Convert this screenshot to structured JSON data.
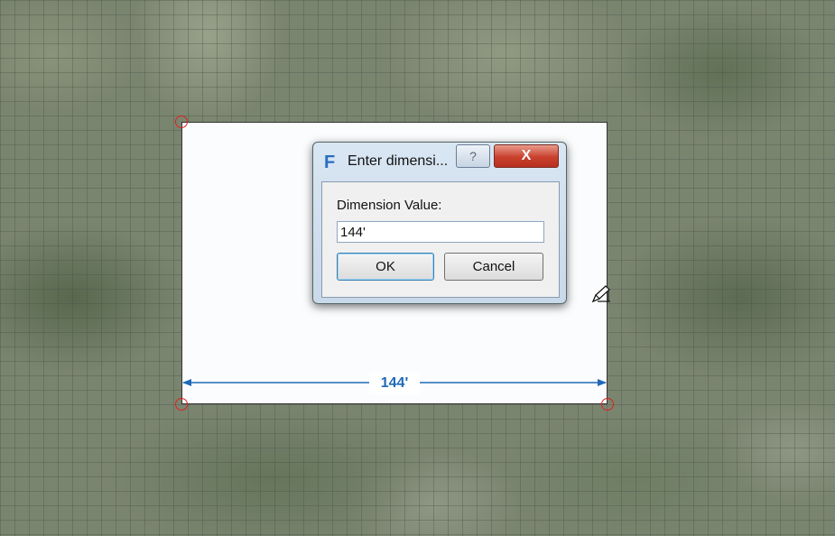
{
  "dialog": {
    "title": "Enter dimensi...",
    "help_label": "?",
    "close_label": "X",
    "field_label": "Dimension Value:",
    "field_value": "144'",
    "ok_label": "OK",
    "cancel_label": "Cancel"
  },
  "sketch": {
    "dimension_label": "144'"
  },
  "icons": {
    "app": "revit-f-icon",
    "cursor": "pencil-cursor-icon"
  },
  "colors": {
    "dimension": "#1f69b8",
    "handle": "#e02020"
  }
}
